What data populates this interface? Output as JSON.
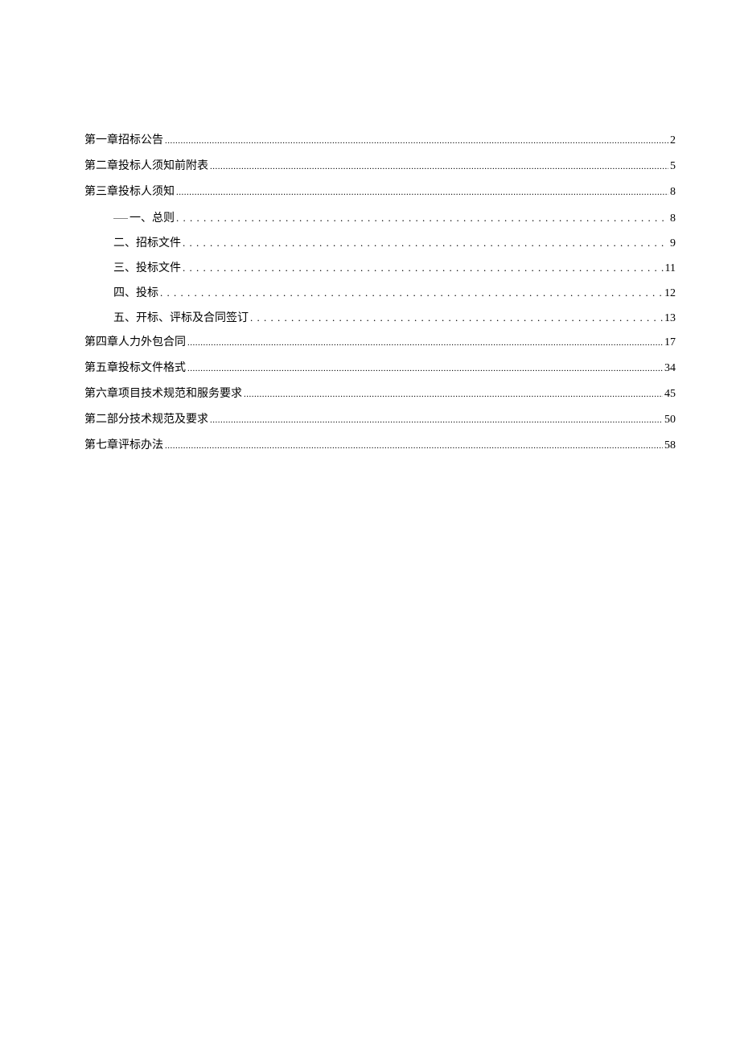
{
  "toc": {
    "entries": [
      {
        "level": 1,
        "title": "第一章招标公告",
        "page": "2",
        "leader": "dense"
      },
      {
        "level": 1,
        "title": "第二章投标人须知前附表",
        "page": "5",
        "leader": "dense"
      },
      {
        "level": 1,
        "title": "第三章投标人须知",
        "page": "8",
        "leader": "dense"
      },
      {
        "level": 2,
        "title": "一、总则",
        "page": "8",
        "leader": "sparse",
        "prefix_mark": true
      },
      {
        "level": 2,
        "title": "二、招标文件",
        "page": "9",
        "leader": "sparse"
      },
      {
        "level": 2,
        "title": "三、投标文件",
        "page": "11",
        "leader": "sparse"
      },
      {
        "level": 2,
        "title": "四、投标",
        "page": "12",
        "leader": "sparse"
      },
      {
        "level": 2,
        "title": "五、开标、评标及合同签订",
        "page": "13",
        "leader": "sparse"
      },
      {
        "level": 1,
        "title": "第四章人力外包合同",
        "page": "17",
        "leader": "dense"
      },
      {
        "level": 1,
        "title": "第五章投标文件格式",
        "page": "34",
        "leader": "dense"
      },
      {
        "level": 1,
        "title": "第六章项目技术规范和服务要求",
        "page": "45",
        "leader": "dense"
      },
      {
        "level": 1,
        "title": "第二部分技术规范及要求",
        "page": "50",
        "leader": "dense"
      },
      {
        "level": 1,
        "title": "第七章评标办法",
        "page": "58",
        "leader": "dense"
      }
    ]
  }
}
